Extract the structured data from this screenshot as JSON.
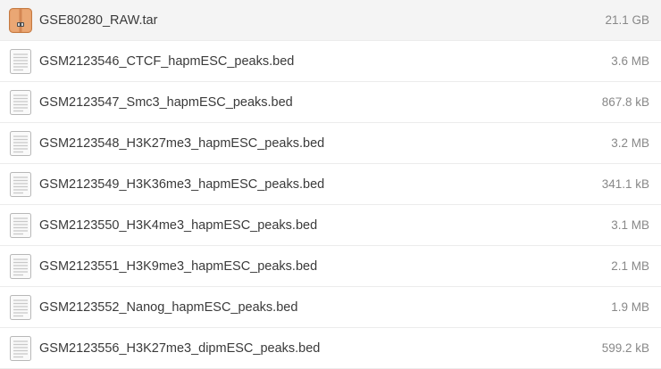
{
  "files": [
    {
      "name": "GSE80280_RAW.tar",
      "size": "21.1 GB",
      "icon": "archive-icon"
    },
    {
      "name": "GSM2123546_CTCF_hapmESC_peaks.bed",
      "size": "3.6 MB",
      "icon": "text-file-icon"
    },
    {
      "name": "GSM2123547_Smc3_hapmESC_peaks.bed",
      "size": "867.8 kB",
      "icon": "text-file-icon"
    },
    {
      "name": "GSM2123548_H3K27me3_hapmESC_peaks.bed",
      "size": "3.2 MB",
      "icon": "text-file-icon"
    },
    {
      "name": "GSM2123549_H3K36me3_hapmESC_peaks.bed",
      "size": "341.1 kB",
      "icon": "text-file-icon"
    },
    {
      "name": "GSM2123550_H3K4me3_hapmESC_peaks.bed",
      "size": "3.1 MB",
      "icon": "text-file-icon"
    },
    {
      "name": "GSM2123551_H3K9me3_hapmESC_peaks.bed",
      "size": "2.1 MB",
      "icon": "text-file-icon"
    },
    {
      "name": "GSM2123552_Nanog_hapmESC_peaks.bed",
      "size": "1.9 MB",
      "icon": "text-file-icon"
    },
    {
      "name": "GSM2123556_H3K27me3_dipmESC_peaks.bed",
      "size": "599.2 kB",
      "icon": "text-file-icon"
    }
  ],
  "colors": {
    "archive": "#e59a5e",
    "archive_dark": "#c7783d",
    "doc_border": "#b5b5b5",
    "doc_lines": "#c8c8c8"
  }
}
